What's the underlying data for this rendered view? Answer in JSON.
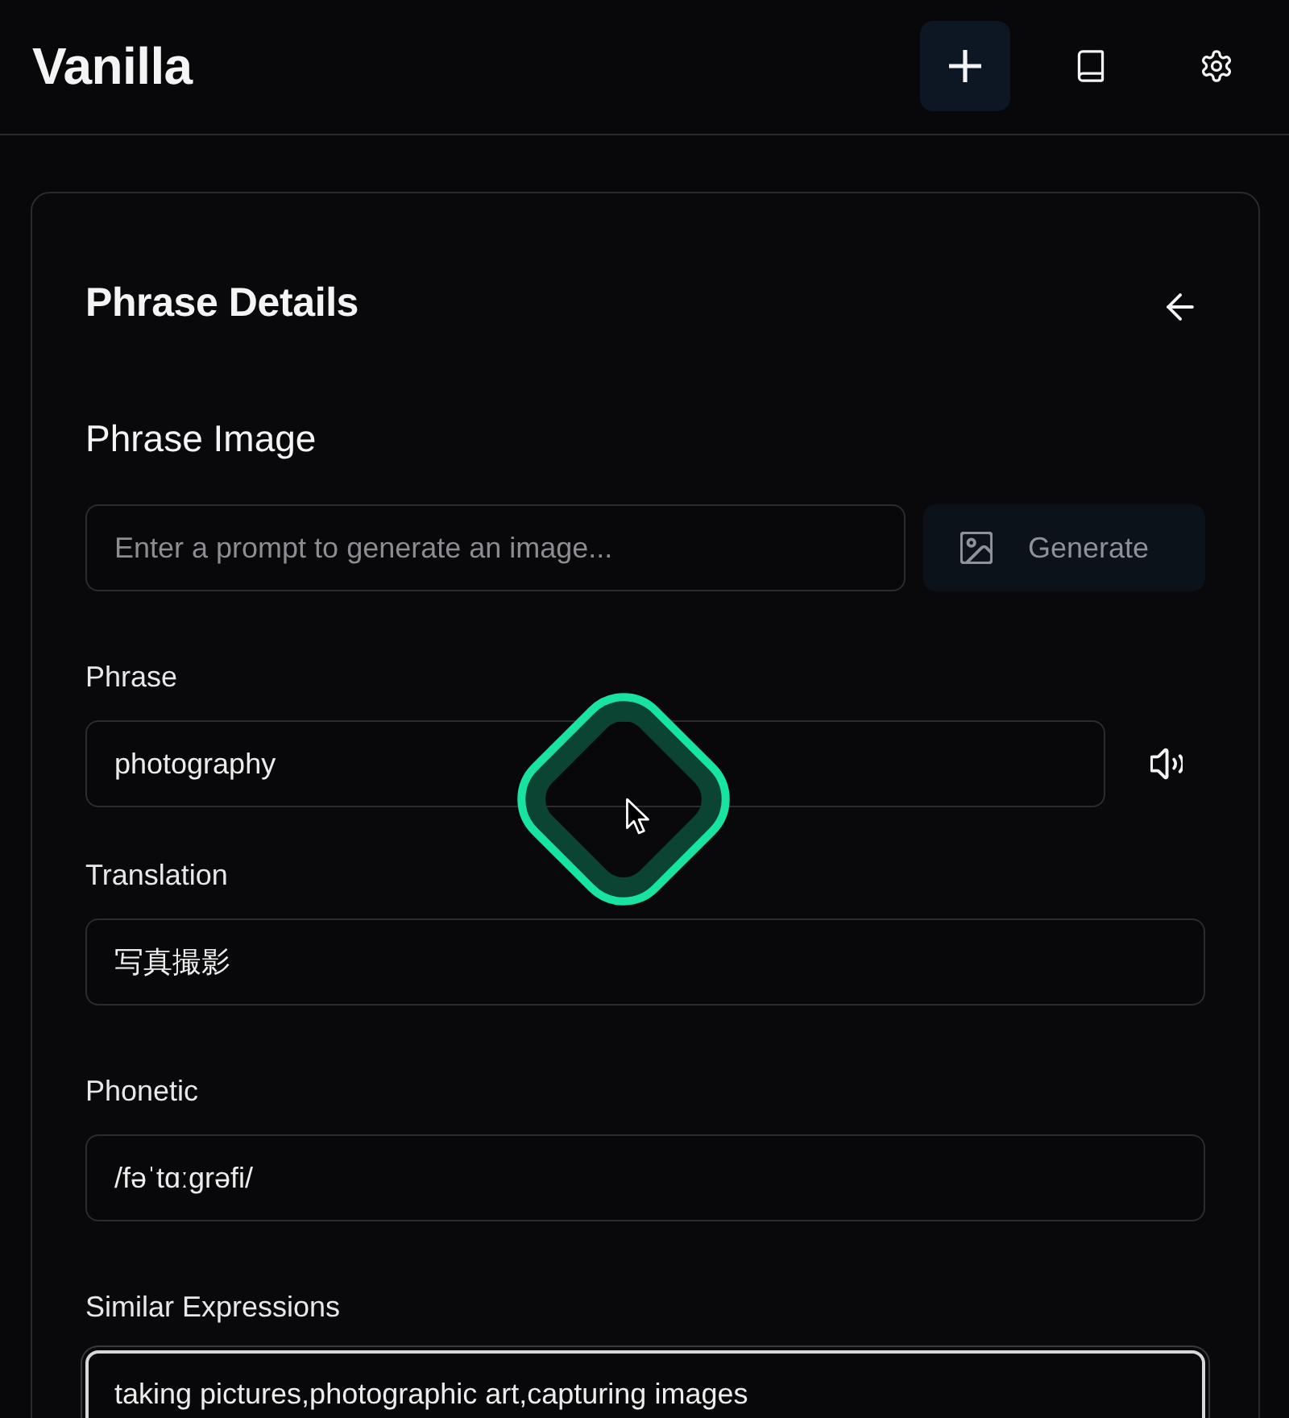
{
  "app": {
    "title": "Vanilla"
  },
  "toolbar": [
    {
      "kind": "add",
      "selected": true
    },
    {
      "kind": "book",
      "selected": false
    },
    {
      "kind": "settings",
      "selected": false
    }
  ],
  "panel": {
    "title": "Phrase Details",
    "image_section": {
      "heading": "Phrase Image",
      "prompt": {
        "placeholder": "Enter a prompt to generate an image..."
      },
      "generate_button": {
        "label": "Generate",
        "disabled": true
      }
    },
    "fields": [
      {
        "kind": "audio",
        "label": "Phrase",
        "value": "photography",
        "focused": false
      },
      {
        "kind": "text",
        "label": "Translation",
        "value": "写真撮影",
        "focused": false
      },
      {
        "kind": "text",
        "label": "Phonetic",
        "value": "/fəˈtɑːgrəfi/",
        "focused": false
      },
      {
        "kind": "text",
        "label": "Similar Expressions",
        "value": "taking pictures,photographic art,capturing images",
        "focused": true
      }
    ]
  }
}
